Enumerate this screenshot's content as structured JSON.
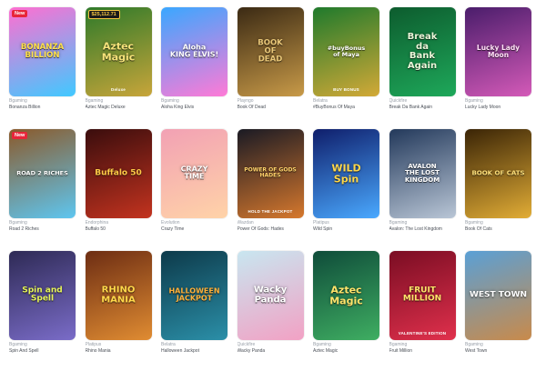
{
  "games": [
    {
      "title": "BONANZA\nBILLION",
      "badge": "New",
      "badge_style": "red",
      "provider": "Bgaming",
      "name": "Bonanza Billion",
      "colors": [
        "#ff6fd1",
        "#40c9ff"
      ],
      "title_color": "#ffe14a",
      "title_size": 8.5
    },
    {
      "title": "Aztec\nMagic",
      "badge": "$25,112.71",
      "badge_style": "gold",
      "sub": "Deluxe",
      "provider": "Bgaming",
      "name": "Aztec Magic Deluxe",
      "colors": [
        "#2e7a2a",
        "#c8a53a"
      ],
      "title_color": "#f6e27a",
      "title_size": 11
    },
    {
      "title": "Aloha\nKING ELVIS!",
      "provider": "Bgaming",
      "name": "Aloha King Elvis",
      "colors": [
        "#3aa7ff",
        "#ff7ad6"
      ],
      "title_color": "#ffffff",
      "title_size": 8
    },
    {
      "title": "BOOK\nOF\nDEAD",
      "provider": "Playngo",
      "name": "Book Of Dead",
      "colors": [
        "#3b2a14",
        "#c89a48"
      ],
      "title_color": "#e9c778",
      "title_size": 8.5
    },
    {
      "title": "#buyBonus\nof Maya",
      "sub": "BUY BONUS",
      "provider": "Belatra",
      "name": "#BuyBonus Of Maya",
      "colors": [
        "#1f7a2c",
        "#d3a937"
      ],
      "title_color": "#ffffff",
      "title_size": 6.5
    },
    {
      "title": "Break\nda\nBank\nAgain",
      "provider": "Quickfire",
      "name": "Break Da Bank Again",
      "colors": [
        "#0d5c2e",
        "#1ea85a"
      ],
      "title_color": "#eaf5d8",
      "title_size": 10
    },
    {
      "title": "Lucky Lady\nMoon",
      "provider": "Bgaming",
      "name": "Lucky Lady Moon",
      "colors": [
        "#4a1d6b",
        "#d45ab8"
      ],
      "title_color": "#ffe1f6",
      "title_size": 7.5
    },
    {
      "title": "ROAD 2 RICHES",
      "badge": "New",
      "badge_style": "red",
      "provider": "Bgaming",
      "name": "Road 2 Riches",
      "colors": [
        "#8b5a2b",
        "#5ec6f0"
      ],
      "title_color": "#ffffff",
      "title_size": 6.5
    },
    {
      "title": "Buffalo 50",
      "provider": "Endorphina",
      "name": "Buffalo 50",
      "colors": [
        "#3a0d0d",
        "#c3331f"
      ],
      "title_color": "#ffcb47",
      "title_size": 9
    },
    {
      "title": "CRAZY\nTIME",
      "provider": "Evolution",
      "name": "Crazy Time",
      "colors": [
        "#f2a1b4",
        "#ffd3a8"
      ],
      "title_color": "#ffffff",
      "title_size": 8
    },
    {
      "title": "POWER OF GODS\nHADES",
      "sub": "HOLD THE JACKPOT",
      "provider": "Wazdan",
      "name": "Power Of Gods: Hades",
      "colors": [
        "#1a1a24",
        "#d6782d"
      ],
      "title_color": "#ffd36a",
      "title_size": 6
    },
    {
      "title": "WILD\nSpin",
      "provider": "Platipus",
      "name": "Wild Spin",
      "colors": [
        "#0f1e6b",
        "#4aa9ff"
      ],
      "title_color": "#ffd84a",
      "title_size": 11
    },
    {
      "title": "AVALON\nTHE LOST KINGDOM",
      "provider": "Bgaming",
      "name": "Avalon: The Lost Kingdom",
      "colors": [
        "#23395b",
        "#b9c6d6"
      ],
      "title_color": "#ffffff",
      "title_size": 7
    },
    {
      "title": "BOOK OF CATS",
      "provider": "Bgaming",
      "name": "Book Of Cats",
      "colors": [
        "#3a2406",
        "#e2ad36"
      ],
      "title_color": "#ffe07a",
      "title_size": 7
    },
    {
      "title": "Spin and\nSpell",
      "provider": "Bgaming",
      "name": "Spin And Spell",
      "colors": [
        "#2e2a55",
        "#7a6cc8"
      ],
      "title_color": "#e7f55a",
      "title_size": 9
    },
    {
      "title": "RHINO\nMANIA",
      "provider": "Platipus",
      "name": "Rhino Mania",
      "colors": [
        "#6d2d13",
        "#e08c32"
      ],
      "title_color": "#ffd84a",
      "title_size": 10
    },
    {
      "title": "HALLOWEEN\nJACKPOT",
      "provider": "Belatra",
      "name": "Halloween Jackpot",
      "colors": [
        "#0d3a4a",
        "#2b8fa8"
      ],
      "title_color": "#ffb13a",
      "title_size": 8
    },
    {
      "title": "Wacky\nPanda",
      "provider": "Quickfire",
      "name": "Wacky Panda",
      "colors": [
        "#c8e6f0",
        "#f2a1c4"
      ],
      "title_color": "#ffffff",
      "title_size": 10
    },
    {
      "title": "Aztec\nMagic",
      "provider": "Bgaming",
      "name": "Aztec Magic",
      "colors": [
        "#0f4c3a",
        "#3fae62"
      ],
      "title_color": "#ffe46a",
      "title_size": 11
    },
    {
      "title": "FRUIT\nMILLION",
      "sub": "VALENTINE'S EDITION",
      "provider": "Bgaming",
      "name": "Fruit Million",
      "colors": [
        "#7a0d23",
        "#e0304c"
      ],
      "title_color": "#ffe46a",
      "title_size": 9
    },
    {
      "title": "WEST TOWN",
      "provider": "Bgaming",
      "name": "West Town",
      "colors": [
        "#5aa0d6",
        "#c98a4a"
      ],
      "title_color": "#ffffff",
      "title_size": 9
    }
  ]
}
